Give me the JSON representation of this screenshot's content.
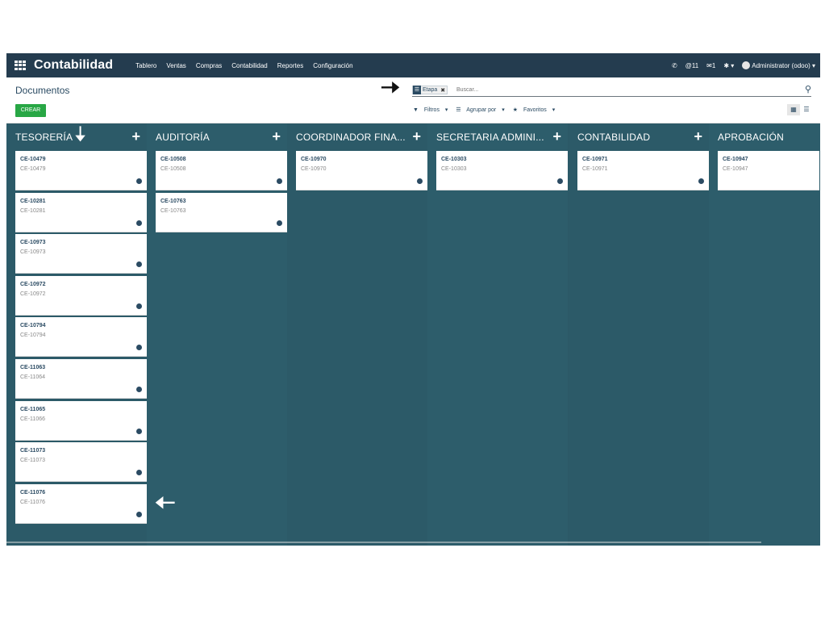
{
  "nav": {
    "brand": "Contabilidad",
    "menu": [
      "Tablero",
      "Ventas",
      "Compras",
      "Contabilidad",
      "Reportes",
      "Configuración"
    ],
    "phone_icon": "phone-icon",
    "activities": "@11",
    "messages": "1",
    "debug_icon": "bug-icon",
    "user": "Administrator (odoo)"
  },
  "control": {
    "title": "Documentos",
    "create_label": "CREAR",
    "facet_label": "Etapa",
    "search_placeholder": "Buscar...",
    "filters_label": "Filtros",
    "groupby_label": "Agrupar por",
    "favorites_label": "Favoritos"
  },
  "columns": [
    {
      "title": "TESORERÍA",
      "cards": [
        {
          "title": "CE-10479",
          "sub": "CE-10479"
        },
        {
          "title": "CE-10281",
          "sub": "CE-10281"
        },
        {
          "title": "CE-10973",
          "sub": "CE-10973"
        },
        {
          "title": "CE-10972",
          "sub": "CE-10972"
        },
        {
          "title": "CE-10794",
          "sub": "CE-10794"
        },
        {
          "title": "CE-11063",
          "sub": "CE-11064"
        },
        {
          "title": "CE-11065",
          "sub": "CE-11066"
        },
        {
          "title": "CE-11073",
          "sub": "CE-11073"
        },
        {
          "title": "CE-11076",
          "sub": "CE-11076"
        }
      ]
    },
    {
      "title": "AUDITORÍA",
      "cards": [
        {
          "title": "CE-10508",
          "sub": "CE-10508"
        },
        {
          "title": "CE-10763",
          "sub": "CE-10763"
        }
      ]
    },
    {
      "title": "COORDINADOR FINA...",
      "cards": [
        {
          "title": "CE-10970",
          "sub": "CE-10970"
        }
      ]
    },
    {
      "title": "SECRETARIA ADMINI...",
      "cards": [
        {
          "title": "CE-10303",
          "sub": "CE-10303"
        }
      ]
    },
    {
      "title": "CONTABILIDAD",
      "cards": [
        {
          "title": "CE-10971",
          "sub": "CE-10971"
        }
      ]
    },
    {
      "title": "APROBACIÓN",
      "cards": [
        {
          "title": "CE-10947",
          "sub": "CE-10947"
        }
      ]
    }
  ]
}
